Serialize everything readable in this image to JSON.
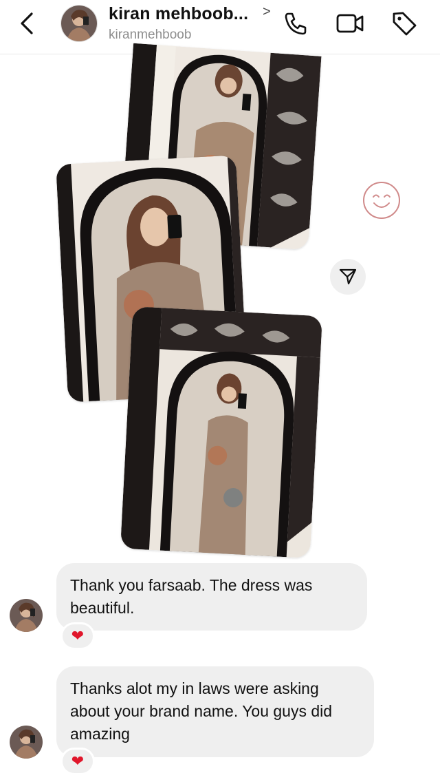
{
  "header": {
    "name": "kiran mehboob...",
    "chevron": ">",
    "username": "kiranmehboob",
    "icons": [
      "back-icon",
      "phone-icon",
      "video-call-icon",
      "tag-icon"
    ]
  },
  "media": {
    "photos": [
      "photo-1",
      "photo-2",
      "photo-3"
    ],
    "smiley_icon": "smiley-icon",
    "send_icon": "send-icon"
  },
  "messages": [
    {
      "text": "Thank you farsaab. The dress was beautiful.",
      "reaction": "❤"
    },
    {
      "text": "Thanks alot my in laws were asking about your brand name. You guys did amazing",
      "reaction": "❤"
    }
  ],
  "colors": {
    "bubble": "#efefef",
    "heart": "#e0162b",
    "muted": "#8e8e8e"
  }
}
